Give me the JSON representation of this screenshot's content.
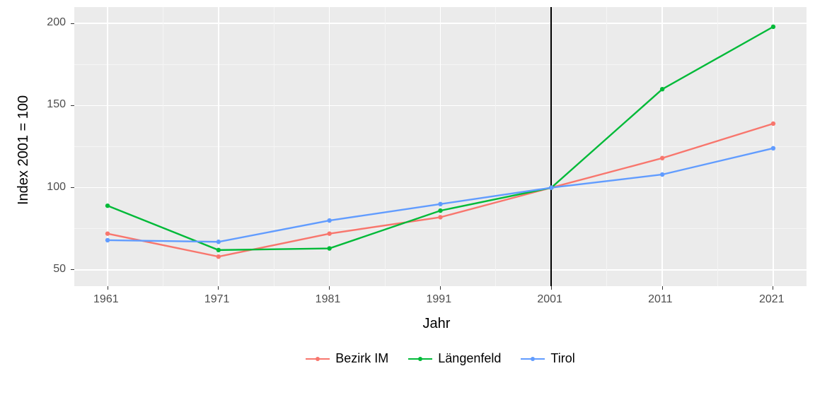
{
  "chart_data": {
    "type": "line",
    "title": "",
    "xlabel": "Jahr",
    "ylabel": "Index 2001 = 100",
    "x": [
      1961,
      1971,
      1981,
      1991,
      2001,
      2011,
      2021
    ],
    "x_ticks": [
      "1961",
      "1971",
      "1981",
      "1991",
      "2001",
      "2011",
      "2021"
    ],
    "y_ticks": [
      "50",
      "100",
      "150",
      "200"
    ],
    "ylim": [
      40,
      210
    ],
    "xlim": [
      1958,
      2024
    ],
    "reference_x": 2001,
    "series": [
      {
        "name": "Bezirk IM",
        "color": "#F8766D",
        "values": [
          72,
          58,
          72,
          82,
          100,
          118,
          139
        ]
      },
      {
        "name": "Längenfeld",
        "color": "#00BA38",
        "values": [
          89,
          62,
          63,
          86,
          100,
          160,
          198
        ]
      },
      {
        "name": "Tirol",
        "color": "#619CFF",
        "values": [
          68,
          67,
          80,
          90,
          100,
          108,
          124
        ]
      }
    ],
    "legend_position": "bottom"
  }
}
